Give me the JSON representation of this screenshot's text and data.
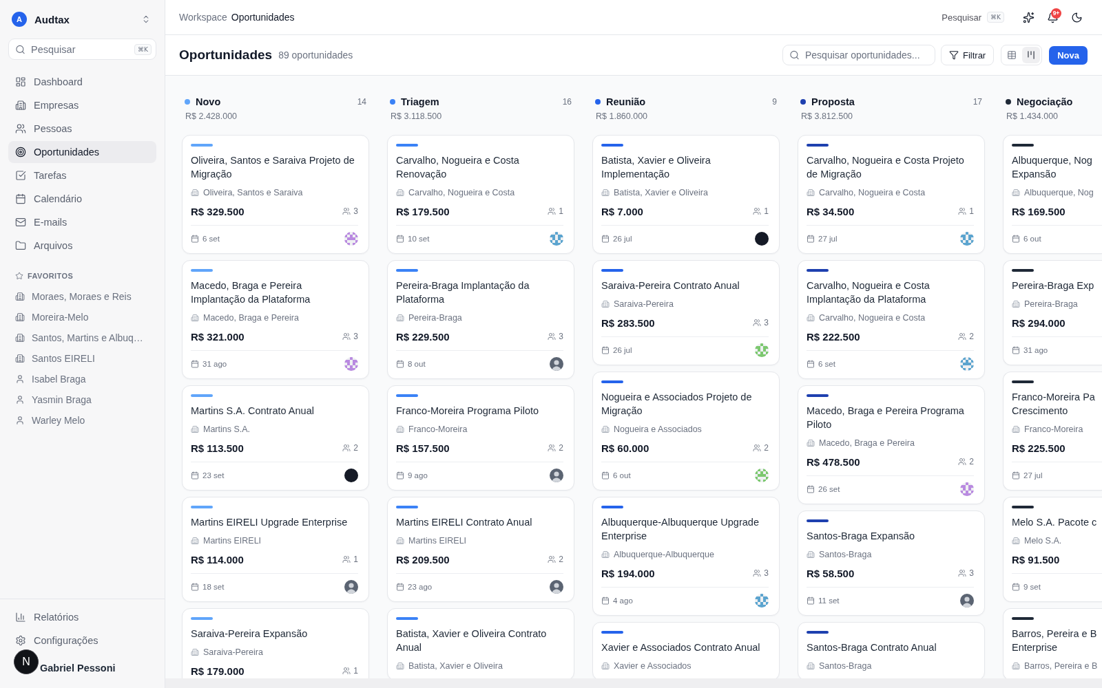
{
  "sidebar": {
    "workspace": {
      "initial": "A",
      "name": "Audtax"
    },
    "search": {
      "placeholder": "Pesquisar",
      "shortcut": "⌘K"
    },
    "nav": [
      {
        "kind": "dashboard",
        "label": "Dashboard",
        "selected": false
      },
      {
        "kind": "companies",
        "label": "Empresas",
        "selected": false
      },
      {
        "kind": "people",
        "label": "Pessoas",
        "selected": false
      },
      {
        "kind": "opportunities",
        "label": "Oportunidades",
        "selected": true
      },
      {
        "kind": "tasks",
        "label": "Tarefas",
        "selected": false
      },
      {
        "kind": "calendar",
        "label": "Calendário",
        "selected": false
      },
      {
        "kind": "email",
        "label": "E-mails",
        "selected": false
      },
      {
        "kind": "files",
        "label": "Arquivos",
        "selected": false
      }
    ],
    "favorites": {
      "title": "FAVORITOS",
      "items": [
        {
          "kind": "company",
          "label": "Moraes, Moraes e Reis"
        },
        {
          "kind": "company",
          "label": "Moreira-Melo"
        },
        {
          "kind": "company",
          "label": "Santos, Martins e Albuq…"
        },
        {
          "kind": "company",
          "label": "Santos EIRELI"
        },
        {
          "kind": "person",
          "label": "Isabel Braga"
        },
        {
          "kind": "person",
          "label": "Yasmin Braga"
        },
        {
          "kind": "person",
          "label": "Warley Melo"
        }
      ]
    },
    "footer": [
      {
        "kind": "reports",
        "label": "Relatórios"
      },
      {
        "kind": "settings",
        "label": "Configurações"
      }
    ],
    "user": {
      "name": "Gabriel Pessoni"
    }
  },
  "dev_badge": {
    "label": "N"
  },
  "header": {
    "breadcrumb": [
      "Workspace",
      "Oportunidades"
    ],
    "search": {
      "label": "Pesquisar",
      "shortcut": "⌘K"
    },
    "notifications": {
      "badge": "9+"
    }
  },
  "toolbar": {
    "title": "Oportunidades",
    "count": "89 oportunidades",
    "search": {
      "placeholder": "Pesquisar oportunidades..."
    },
    "filter": "Filtrar",
    "views": [
      {
        "kind": "table",
        "selected": false
      },
      {
        "kind": "board",
        "selected": true
      }
    ],
    "new_button": "Nova"
  },
  "board": {
    "columns": [
      {
        "name": "Novo",
        "color": "#60a5fa",
        "count": "14",
        "total": "R$ 2.428.000",
        "cards": [
          {
            "title": "Oliveira, Santos e Saraiva Projeto de Migração",
            "company": "Oliveira, Santos e Saraiva",
            "amount": "R$ 329.500",
            "people": "3",
            "date": "6 set",
            "avatar": {
              "kind": "pattern",
              "color": "#b98ae0"
            }
          },
          {
            "title": "Macedo, Braga e Pereira Implantação da Plataforma",
            "company": "Macedo, Braga e Pereira",
            "amount": "R$ 321.000",
            "people": "3",
            "date": "31 ago",
            "avatar": {
              "kind": "pattern",
              "color": "#b98ae0"
            }
          },
          {
            "title": "Martins S.A. Contrato Anual",
            "company": "Martins S.A.",
            "amount": "R$ 113.500",
            "people": "2",
            "date": "23 set",
            "avatar": {
              "kind": "solid",
              "color": "#151a26"
            }
          },
          {
            "title": "Martins EIRELI Upgrade Enterprise",
            "company": "Martins EIRELI",
            "amount": "R$ 114.000",
            "people": "1",
            "date": "18 set",
            "avatar": {
              "kind": "photo"
            }
          },
          {
            "title": "Saraiva-Pereira Expansão",
            "company": "Saraiva-Pereira",
            "amount": "R$ 179.000",
            "people": "1"
          }
        ]
      },
      {
        "name": "Triagem",
        "color": "#3b82f6",
        "count": "16",
        "total": "R$ 3.118.500",
        "cards": [
          {
            "title": "Carvalho, Nogueira e Costa Renovação",
            "company": "Carvalho, Nogueira e Costa",
            "amount": "R$ 179.500",
            "people": "1",
            "date": "10 set",
            "avatar": {
              "kind": "pattern",
              "color": "#5ba4cf"
            }
          },
          {
            "title": "Pereira-Braga Implantação da Plataforma",
            "company": "Pereira-Braga",
            "amount": "R$ 229.500",
            "people": "3",
            "date": "8 out",
            "avatar": {
              "kind": "photo"
            }
          },
          {
            "title": "Franco-Moreira Programa Piloto",
            "company": "Franco-Moreira",
            "amount": "R$ 157.500",
            "people": "2",
            "date": "9 ago",
            "avatar": {
              "kind": "photo"
            }
          },
          {
            "title": "Martins EIRELI Contrato Anual",
            "company": "Martins EIRELI",
            "amount": "R$ 209.500",
            "people": "2",
            "date": "23 ago",
            "avatar": {
              "kind": "photo"
            }
          },
          {
            "title": "Batista, Xavier e Oliveira Contrato Anual",
            "company": "Batista, Xavier e Oliveira"
          }
        ]
      },
      {
        "name": "Reunião",
        "color": "#2563eb",
        "count": "9",
        "total": "R$ 1.860.000",
        "cards": [
          {
            "title": "Batista, Xavier e Oliveira Implementação",
            "company": "Batista, Xavier e Oliveira",
            "amount": "R$ 7.000",
            "people": "1",
            "date": "26 jul",
            "avatar": {
              "kind": "solid",
              "color": "#151a26"
            }
          },
          {
            "title": "Saraiva-Pereira Contrato Anual",
            "company": "Saraiva-Pereira",
            "amount": "R$ 283.500",
            "people": "3",
            "date": "26 jul",
            "avatar": {
              "kind": "pattern",
              "color": "#7cc86f"
            }
          },
          {
            "title": "Nogueira e Associados Projeto de Migração",
            "company": "Nogueira e Associados",
            "amount": "R$ 60.000",
            "people": "2",
            "date": "6 out",
            "avatar": {
              "kind": "pattern",
              "color": "#7cc86f"
            }
          },
          {
            "title": "Albuquerque-Albuquerque Upgrade Enterprise",
            "company": "Albuquerque-Albuquerque",
            "amount": "R$ 194.000",
            "people": "3",
            "date": "4 ago",
            "avatar": {
              "kind": "pattern",
              "color": "#5ba4cf"
            }
          },
          {
            "title": "Xavier e Associados Contrato Anual",
            "company": "Xavier e Associados"
          }
        ]
      },
      {
        "name": "Proposta",
        "color": "#1e40af",
        "count": "17",
        "total": "R$ 3.812.500",
        "cards": [
          {
            "title": "Carvalho, Nogueira e Costa Projeto de Migração",
            "company": "Carvalho, Nogueira e Costa",
            "amount": "R$ 34.500",
            "people": "1",
            "date": "27 jul",
            "avatar": {
              "kind": "pattern",
              "color": "#5ba4cf"
            }
          },
          {
            "title": "Carvalho, Nogueira e Costa Implantação da Plataforma",
            "company": "Carvalho, Nogueira e Costa",
            "amount": "R$ 222.500",
            "people": "2",
            "date": "6 set",
            "avatar": {
              "kind": "pattern",
              "color": "#5ba4cf"
            }
          },
          {
            "title": "Macedo, Braga e Pereira Programa Piloto",
            "company": "Macedo, Braga e Pereira",
            "amount": "R$ 478.500",
            "people": "2",
            "date": "26 set",
            "avatar": {
              "kind": "pattern",
              "color": "#b98ae0"
            }
          },
          {
            "title": "Santos-Braga Expansão",
            "company": "Santos-Braga",
            "amount": "R$ 58.500",
            "people": "3",
            "date": "11 set",
            "avatar": {
              "kind": "photo"
            }
          },
          {
            "title": "Santos-Braga Contrato Anual",
            "company": "Santos-Braga"
          }
        ]
      },
      {
        "name": "Negociação",
        "color": "#1f2937",
        "total": "R$ 1.434.000",
        "cards": [
          {
            "title": "Albuquerque, Nog\nExpansão",
            "company": "Albuquerque, Nog",
            "amount": "R$ 169.500",
            "date": "6 out"
          },
          {
            "title": "Pereira-Braga Exp",
            "company": "Pereira-Braga",
            "amount": "R$ 294.000",
            "date": "31 ago"
          },
          {
            "title": "Franco-Moreira Pa\nCrescimento",
            "company": "Franco-Moreira",
            "amount": "R$ 225.500",
            "date": "27 jul"
          },
          {
            "title": "Melo S.A. Pacote c",
            "company": "Melo S.A.",
            "amount": "R$ 91.500",
            "date": "9 set"
          },
          {
            "title": "Barros, Pereira e B\nEnterprise",
            "company": "Barros, Pereira e B"
          }
        ]
      }
    ]
  }
}
